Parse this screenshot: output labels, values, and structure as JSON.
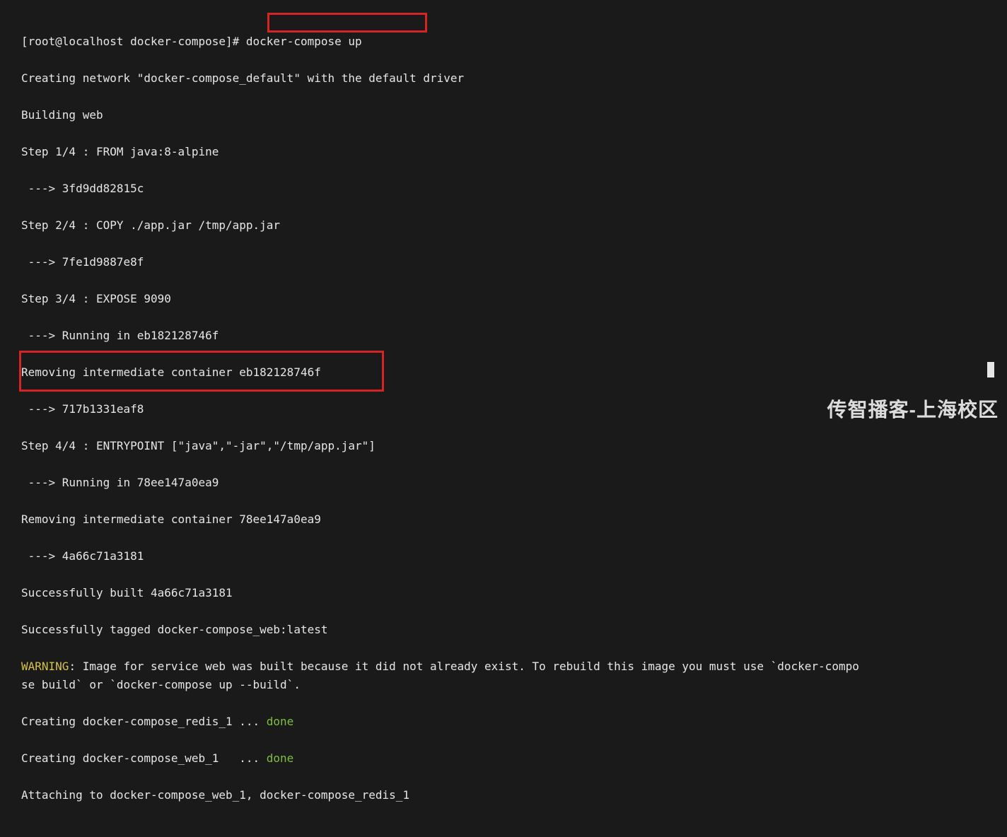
{
  "prompt": "[root@localhost docker-compose]# ",
  "command": "docker-compose up",
  "lines": {
    "l1": "Creating network \"docker-compose_default\" with the default driver",
    "l2": "Building web",
    "l3": "Step 1/4 : FROM java:8-alpine",
    "l4": " ---> 3fd9dd82815c",
    "l5": "Step 2/4 : COPY ./app.jar /tmp/app.jar",
    "l6": " ---> 7fe1d9887e8f",
    "l7": "Step 3/4 : EXPOSE 9090",
    "l8": " ---> Running in eb182128746f",
    "l9": "Removing intermediate container eb182128746f",
    "l10": " ---> 717b1331eaf8",
    "l11": "Step 4/4 : ENTRYPOINT [\"java\",\"-jar\",\"/tmp/app.jar\"]",
    "l12": " ---> Running in 78ee147a0ea9",
    "l13": "Removing intermediate container 78ee147a0ea9",
    "l14": " ---> 4a66c71a3181",
    "l15": "Successfully built 4a66c71a3181",
    "l16": "Successfully tagged docker-compose_web:latest"
  },
  "warning": {
    "label": "WARNING",
    "text": ": Image for service web was built because it did not already exist. To rebuild this image you must use `docker-compo\nse build` or `docker-compose up --build`."
  },
  "creating": {
    "redis_prefix": "Creating docker-compose_redis_1 ... ",
    "web_prefix": "Creating docker-compose_web_1   ... ",
    "done": "done"
  },
  "attach": "Attaching to docker-compose_web_1, docker-compose_redis_1",
  "watermark": "传智播客-上海校区"
}
